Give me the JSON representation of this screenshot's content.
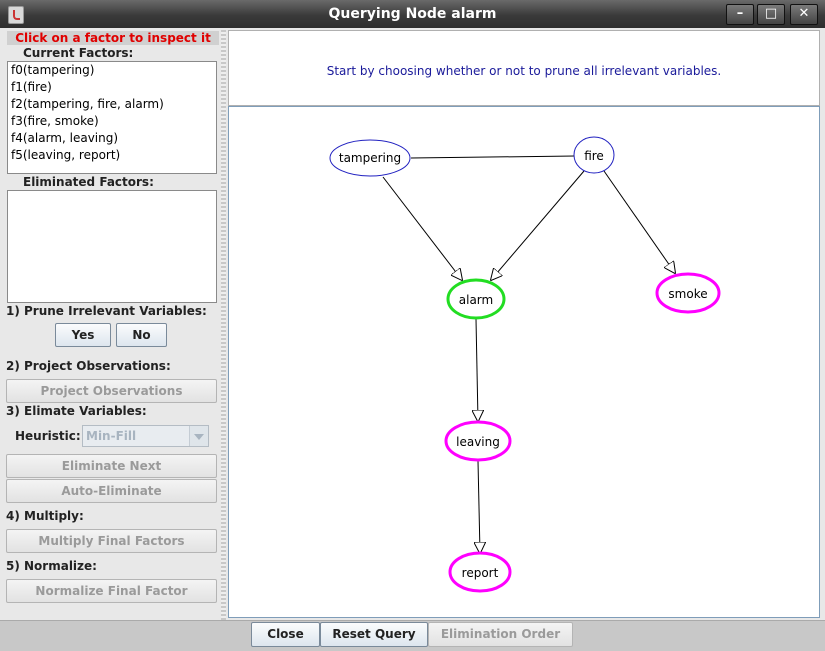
{
  "window": {
    "title": "Querying Node alarm"
  },
  "left_panel": {
    "hint": "Click on a factor to inspect it",
    "current_factors_label": "Current Factors:",
    "current_factors": [
      "f0(tampering)",
      "f1(fire)",
      "f2(tampering, fire, alarm)",
      "f3(fire, smoke)",
      "f4(alarm, leaving)",
      "f5(leaving, report)"
    ],
    "eliminated_factors_label": "Eliminated Factors:",
    "step1_label": "1) Prune Irrelevant Variables:",
    "yes_label": "Yes",
    "no_label": "No",
    "step2_label": "2) Project Observations:",
    "project_button": "Project Observations",
    "step3_label": "3) Elimate Variables:",
    "heuristic_label": "Heuristic:",
    "heuristic_value": "Min-Fill",
    "eliminate_next_button": "Eliminate Next",
    "auto_eliminate_button": "Auto-Eliminate",
    "step4_label": "4) Multiply:",
    "multiply_button": "Multiply Final Factors",
    "step5_label": "5) Normalize:",
    "normalize_button": "Normalize Final Factor"
  },
  "message": "Start by choosing whether or not to prune all irrelevant variables.",
  "graph": {
    "colors": {
      "normal": "#2020c0",
      "query": "#22dd22",
      "irrelevant": "#ff00ff"
    },
    "nodes": {
      "tampering": "tampering",
      "fire": "fire",
      "alarm": "alarm",
      "smoke": "smoke",
      "leaving": "leaving",
      "report": "report"
    }
  },
  "bottom": {
    "close_button": "Close",
    "reset_button": "Reset Query",
    "elimination_order_button": "Elimination Order"
  }
}
